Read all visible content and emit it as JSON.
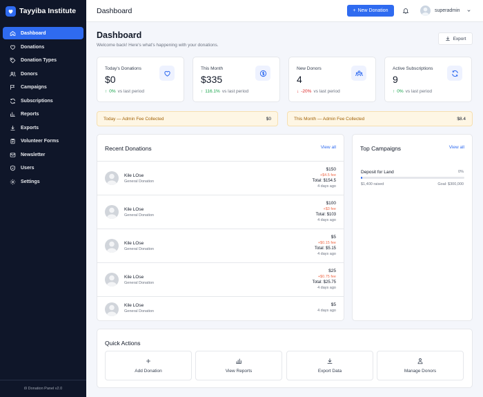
{
  "brand": {
    "name": "Tayyiba Institute"
  },
  "sidebar": {
    "items": [
      {
        "label": "Dashboard",
        "icon": "home-icon",
        "active": true
      },
      {
        "label": "Donations",
        "icon": "heart-icon"
      },
      {
        "label": "Donation Types",
        "icon": "tag-icon"
      },
      {
        "label": "Donors",
        "icon": "users-icon"
      },
      {
        "label": "Campaigns",
        "icon": "flag-icon"
      },
      {
        "label": "Subscriptions",
        "icon": "refresh-icon"
      },
      {
        "label": "Reports",
        "icon": "bar-chart-icon"
      },
      {
        "label": "Exports",
        "icon": "download-icon"
      },
      {
        "label": "Volunteer Forms",
        "icon": "clipboard-icon"
      },
      {
        "label": "Newsletter",
        "icon": "mail-icon"
      },
      {
        "label": "Users",
        "icon": "shield-icon"
      },
      {
        "label": "Settings",
        "icon": "gear-icon"
      }
    ],
    "footer": "i9 Donation Panel v2.0"
  },
  "topbar": {
    "title": "Dashboard",
    "new_donation_label": "New Donation",
    "user_name": "superadmin"
  },
  "header": {
    "title": "Dashboard",
    "subtitle": "Welcome back! Here's what's happening with your donations.",
    "export_label": "Export"
  },
  "stats": [
    {
      "label": "Today's Donations",
      "value": "$0",
      "change": "0%",
      "direction": "up",
      "vs": "vs last period",
      "icon": "heart-icon"
    },
    {
      "label": "This Month",
      "value": "$335",
      "change": "116.1%",
      "direction": "up",
      "vs": "vs last period",
      "icon": "dollar-icon"
    },
    {
      "label": "New Donors",
      "value": "4",
      "change": "-20%",
      "direction": "down",
      "vs": "vs last period",
      "icon": "users-icon"
    },
    {
      "label": "Active Subscriptions",
      "value": "9",
      "change": "0%",
      "direction": "up",
      "vs": "vs last period",
      "icon": "refresh-icon"
    }
  ],
  "fees": {
    "today": {
      "label": "Today — Admin Fee Collected",
      "value": "$0"
    },
    "month": {
      "label": "This Month — Admin Fee Collected",
      "value": "$8.4"
    }
  },
  "recent": {
    "title": "Recent Donations",
    "view_all": "View all",
    "rows": [
      {
        "name": "Kile LOse",
        "type": "General Donation",
        "amount": "$150",
        "fee": "+$4.5 fee",
        "total": "Total: $154.5",
        "ago": "4 days ago"
      },
      {
        "name": "Kile LOse",
        "type": "General Donation",
        "amount": "$100",
        "fee": "+$3 fee",
        "total": "Total: $103",
        "ago": "4 days ago"
      },
      {
        "name": "Kile LOse",
        "type": "General Donation",
        "amount": "$5",
        "fee": "+$0.15 fee",
        "total": "Total: $5.15",
        "ago": "4 days ago"
      },
      {
        "name": "Kile LOse",
        "type": "General Donation",
        "amount": "$25",
        "fee": "+$0.75 fee",
        "total": "Total: $25.75",
        "ago": "4 days ago"
      },
      {
        "name": "Kile LOse",
        "type": "General Donation",
        "amount": "$5",
        "fee": "",
        "total": "",
        "ago": "4 days ago"
      }
    ]
  },
  "campaigns": {
    "title": "Top Campaigns",
    "view_all": "View all",
    "items": [
      {
        "name": "Deposit for Land",
        "percent": "0%",
        "progress": 0.0047,
        "raised": "$1,400 raised",
        "goal": "Goal: $300,000"
      }
    ]
  },
  "quick_actions": {
    "title": "Quick Actions",
    "items": [
      {
        "label": "Add Donation",
        "icon": "plus-icon"
      },
      {
        "label": "View Reports",
        "icon": "bar-chart-icon"
      },
      {
        "label": "Export Data",
        "icon": "download-icon"
      },
      {
        "label": "Manage Donors",
        "icon": "users-icon"
      }
    ]
  },
  "colors": {
    "accent": "#2f6bf0",
    "sidebar": "#0f1629",
    "up": "#16a34a",
    "down": "#dc2626",
    "fee_bg": "#fef6e4"
  }
}
